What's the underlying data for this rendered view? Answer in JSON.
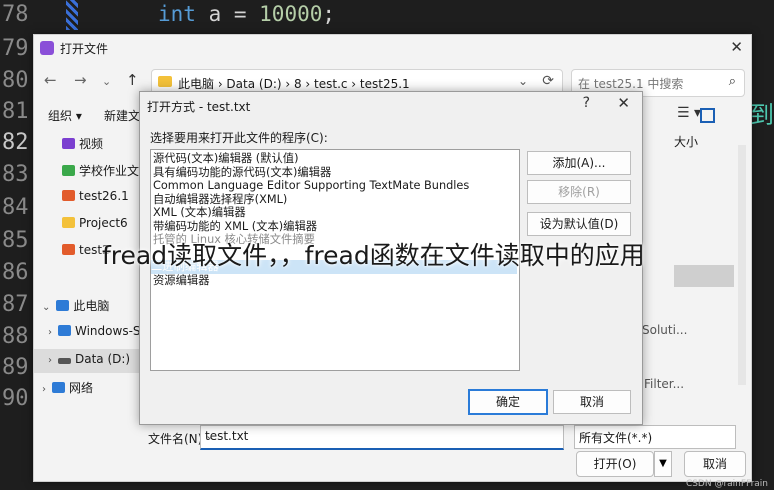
{
  "editor": {
    "line_numbers": [
      "78",
      "79",
      "80",
      "81",
      "82",
      "83",
      "84",
      "85",
      "86",
      "87",
      "88",
      "89",
      "90"
    ],
    "code_keyword": "int",
    "code_var": " a = ",
    "code_num": "10000",
    "code_end": ";",
    "side_glyph": "到"
  },
  "outer_dialog": {
    "title": "打开文件",
    "breadcrumb": "此电脑  ›  Data (D:)  ›  8  ›  test.c  ›  test25.1",
    "search_placeholder": "在 test25.1 中搜索",
    "toolbar": {
      "organize": "组织 ▾",
      "new_folder": "新建文件"
    },
    "sidebar": [
      {
        "label": "视频",
        "color": "#7b3fd0"
      },
      {
        "label": "学校作业文件",
        "color": "#3aa84a"
      },
      {
        "label": "test26.1",
        "color": "#e25b2b"
      },
      {
        "label": "Project6",
        "color": "#f3c13a"
      },
      {
        "label": "test2",
        "color": "#e25b2b"
      },
      {
        "label": "此电脑",
        "color": "#2e7bd6"
      },
      {
        "label": "Windows-S",
        "color": "#2e7bd6"
      },
      {
        "label": "Data (D:)",
        "color": "#555555"
      },
      {
        "label": "网络",
        "color": "#2e7bd6"
      }
    ],
    "column_size": "大小",
    "right_text_1": "Soluti...",
    "right_text_2": "Filter...",
    "filename_label": "文件名(N):",
    "filename_value": "test.txt",
    "filetype_value": "所有文件(*.*)",
    "open_button": "打开(O)",
    "cancel_button": "取消"
  },
  "open_with": {
    "title": "打开方式 - test.txt",
    "prompt": "选择要用来打开此文件的程序(C):",
    "programs": [
      "源代码(文本)编辑器 (默认值)",
      "具有编码功能的源代码(文本)编辑器",
      "Common Language Editor Supporting TextMate Bundles",
      "自动编辑器选择程序(XML)",
      "XML (文本)编辑器",
      "带编码功能的 XML (文本)编辑器",
      "托管的 Linux 核心转储文件摘要",
      "二进制编辑器",
      "资源编辑器"
    ],
    "add_button": "添加(A)...",
    "remove_button": "移除(R)",
    "set_default_button": "设为默认值(D)",
    "ok_button": "确定",
    "cancel_button": "取消"
  },
  "overlay_text": "fread读取文件，，fread函数在文件读取中的应用",
  "credit": "CSDN @rainFFrain"
}
